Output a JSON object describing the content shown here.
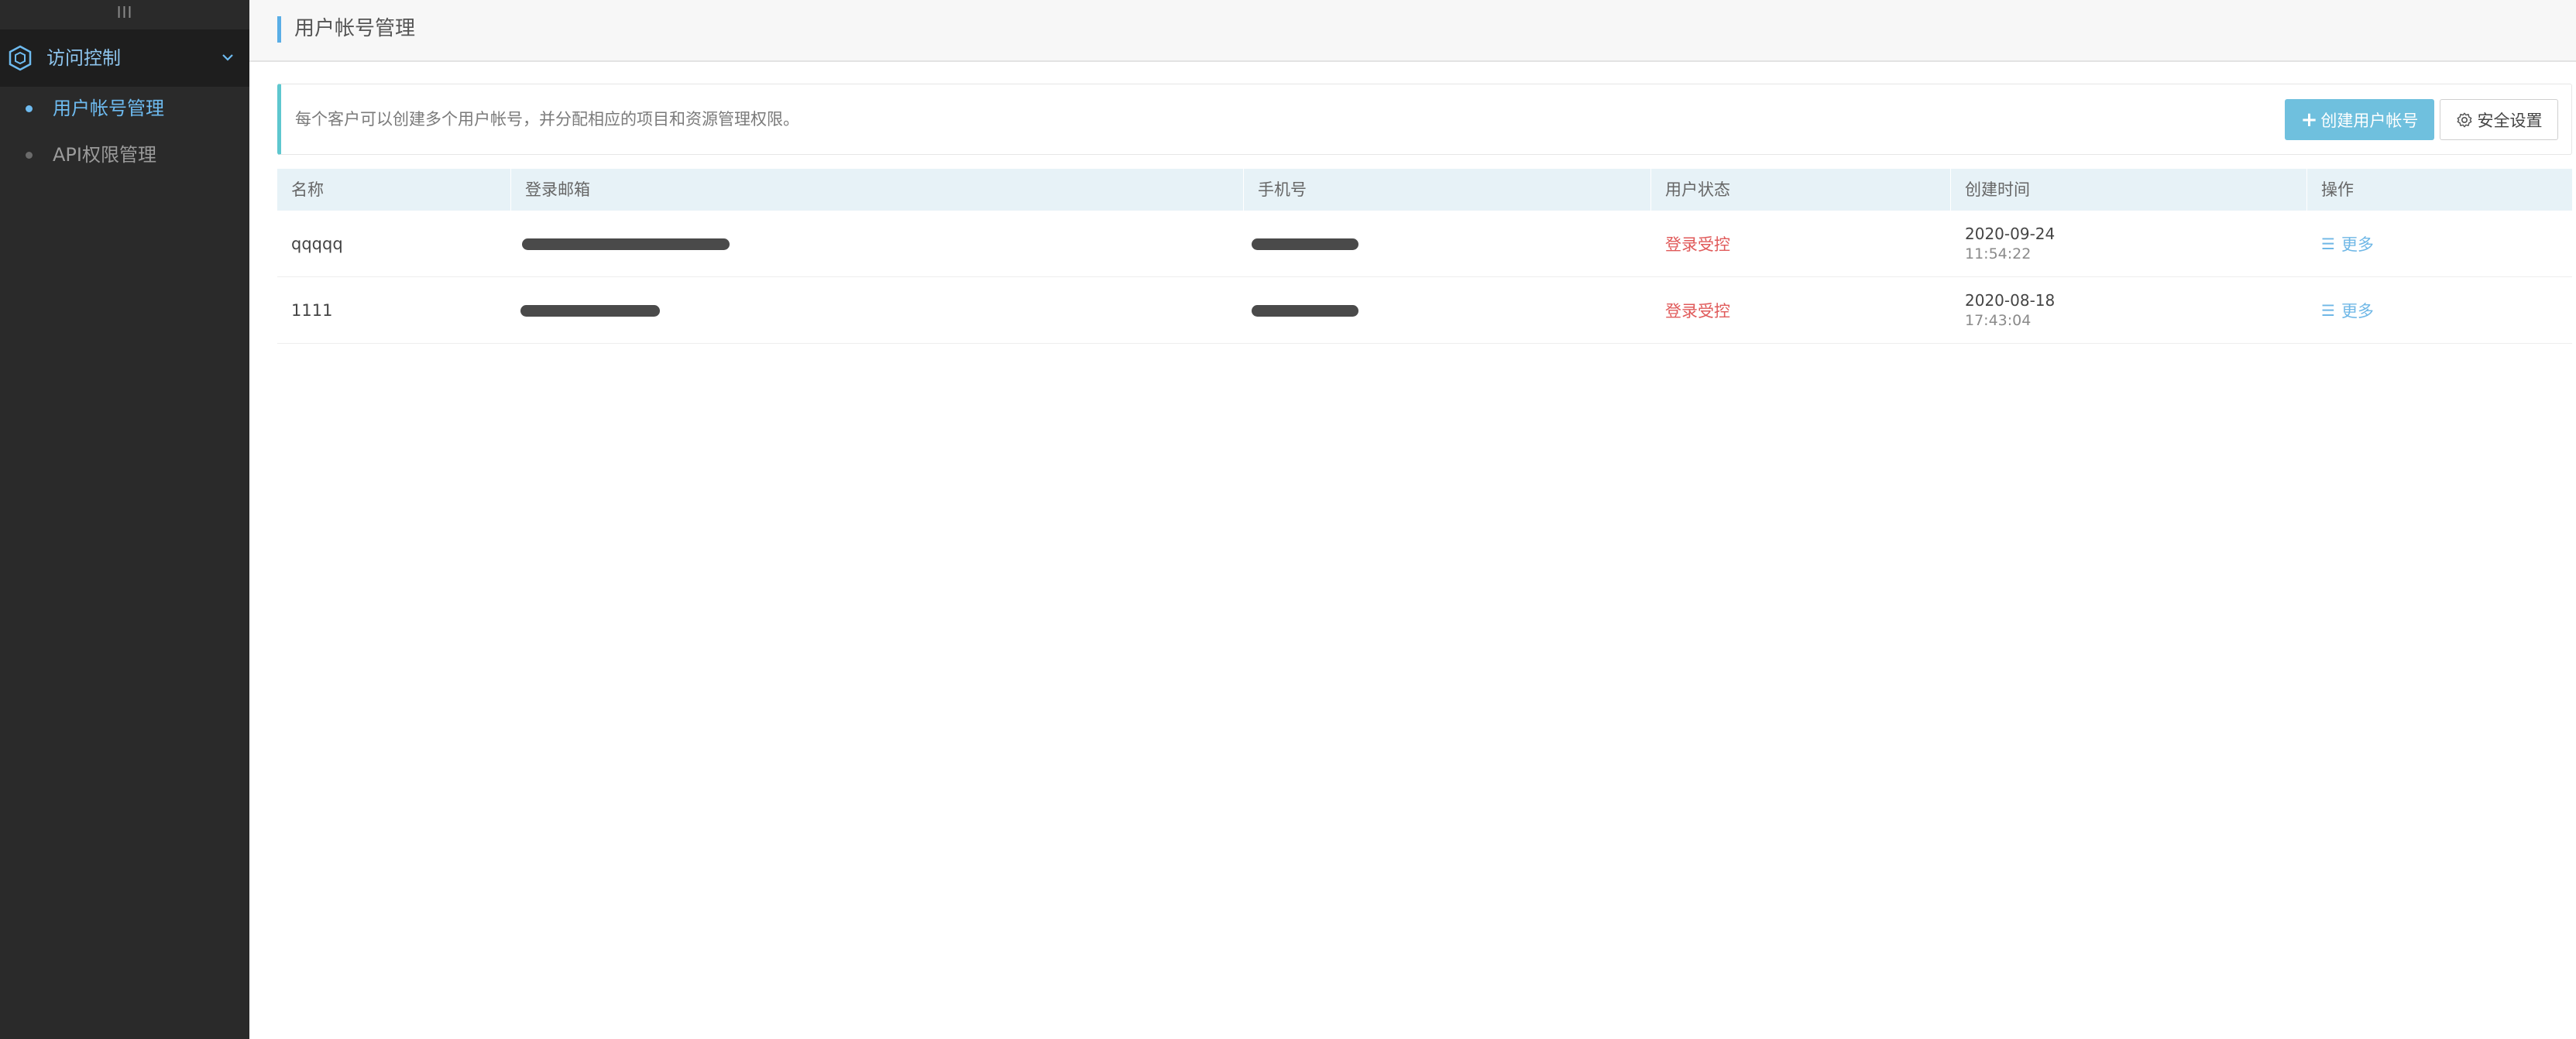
{
  "sidebar": {
    "collapse_handle": "III",
    "group": {
      "label": "访问控制",
      "icon": "hexagon-shield-icon",
      "chevron": "chevron-down-icon"
    },
    "items": [
      {
        "label": "用户帐号管理",
        "active": true
      },
      {
        "label": "API权限管理",
        "active": false
      }
    ]
  },
  "header": {
    "title": "用户帐号管理"
  },
  "info_panel": {
    "text": "每个客户可以创建多个用户帐号，并分配相应的项目和资源管理权限。",
    "create_button": {
      "icon": "+",
      "label": "创建用户帐号"
    },
    "security_button": {
      "icon": "gear-icon",
      "label": "安全设置"
    }
  },
  "table": {
    "columns": [
      "名称",
      "登录邮箱",
      "手机号",
      "用户状态",
      "创建时间",
      "操作"
    ],
    "rows": [
      {
        "name": "qqqqq",
        "status": "登录受控",
        "created_date": "2020-09-24",
        "created_time": "11:54:22",
        "action": "更多"
      },
      {
        "name": "1111",
        "status": "登录受控",
        "created_date": "2020-08-18",
        "created_time": "17:43:04",
        "action": "更多"
      }
    ]
  },
  "colors": {
    "sidebar_bg": "#2a2a2a",
    "active_blue": "#6ebbf0",
    "primary_button": "#6fc0de",
    "status_red": "#e05a5a",
    "table_header_bg": "#e7f2f7",
    "info_accent": "#5ec7cf"
  }
}
